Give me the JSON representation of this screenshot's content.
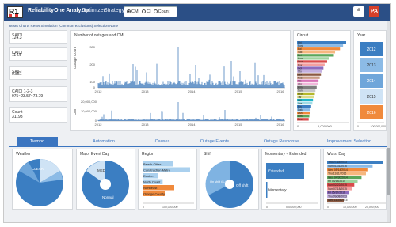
{
  "header": {
    "logo": "R1",
    "title": "ReliabilityOne Analyzer",
    "nav": [
      "Optimizer",
      "Strategy"
    ],
    "metric_options": [
      {
        "label": "CMI",
        "selected": true
      },
      {
        "label": "CI",
        "selected": false
      },
      {
        "label": "Count",
        "selected": false
      }
    ],
    "collapse_icon": "double-chevron-down-icon",
    "user_badge": "PA"
  },
  "breadcrumb": "Reset Charts  Reset Simulation (Common exclusions)  Selection None",
  "metrics": [
    {
      "label": "SAIDI",
      "value": "124.3"
    },
    {
      "label": "CAIDI",
      "value": "114.5"
    },
    {
      "label": "SAIFI",
      "value": "0.851"
    },
    {
      "label": "CAIDI 1-2-3",
      "value": "975~23.57~73.79"
    },
    {
      "label": "Count",
      "value": "31198"
    }
  ],
  "timeline": {
    "title": "Number of outages and CMI",
    "upper_ylabel": "Outage Count",
    "lower_ylabel": "CMI",
    "upper_ticks": [
      "300",
      "200",
      "100",
      "0"
    ],
    "lower_ticks": [
      "20,000,000",
      "10,000,000",
      "0"
    ],
    "x_ticks": [
      "2012",
      "2013",
      "2014",
      "2015",
      "2016"
    ]
  },
  "circuit": {
    "title": "Circuit",
    "x_ticks": [
      "0",
      "5,000,000"
    ],
    "rows": [
      "Shi",
      "Rost",
      "Bal",
      "Sali",
      "Del",
      "Hom",
      "Dua",
      "Fox",
      "Gol",
      "Sto",
      "Lex",
      "Pos",
      "Vix",
      "Chr",
      "Kim",
      "Sun",
      "Bea",
      "Tar",
      "Wil",
      "Gre",
      "Pin",
      "Dak",
      "Ash",
      "Elm",
      "Ree"
    ],
    "values": [
      8,
      7.5,
      7,
      6.2,
      6,
      5.2,
      4.9,
      4.5,
      4.3,
      4.1,
      3.9,
      3.7,
      3.5,
      3.4,
      3.2,
      3,
      2.9,
      2.8,
      2.6,
      2.5,
      2.3,
      2.2,
      2.1,
      2,
      1.9
    ]
  },
  "year": {
    "title": "Year",
    "items": [
      "2012",
      "2013",
      "2014",
      "2015",
      "2016"
    ],
    "axis": "0",
    "axis_end": "100,000,000"
  },
  "tabs": [
    "Tiempo",
    "Automation",
    "Causes",
    "Outage Events",
    "Outage Response",
    "Improvement Selection"
  ],
  "weather": {
    "title": "Weather",
    "label": "CLEAR"
  },
  "major_event": {
    "title": "Major Event Day",
    "labels": [
      "MED",
      "Normal"
    ]
  },
  "region": {
    "title": "Region",
    "items": [
      "Beach Cities",
      "Construction Metro",
      "Eastern",
      "North Coast",
      "Northeast",
      "Orange County"
    ],
    "values": [
      58,
      90,
      30,
      38,
      60,
      42
    ],
    "colors": [
      "#aad0ee",
      "#aad0ee",
      "#aad0ee",
      "#aad0ee",
      "#f08a3c",
      "#f08a3c"
    ],
    "x_ticks": [
      "0",
      "100,000,000"
    ]
  },
  "shift": {
    "title": "Shift",
    "labels": [
      "On shift (8-4pm)",
      "Off shift"
    ]
  },
  "momentary": {
    "title": "Momentary v Extended",
    "items": [
      "Extended",
      "Momentary"
    ],
    "values": [
      100,
      2
    ],
    "x_ticks": [
      "0",
      "500,000,000"
    ]
  },
  "week_day": {
    "title": "Worst Day",
    "items": [
      "Thu 07/18/2013",
      "Sun 01/31/2016",
      "Wed 05/14/2014",
      "Thu 11/11/2016",
      "Wed 04/30/2014",
      "Fri 04/18/2014",
      "Sun 02/22/2015",
      "Sun 07/18/2015",
      "Fri 05/17/2016",
      "Thu 09/08/2013",
      "Wed 11/25/2015"
    ],
    "values": [
      100,
      82,
      74,
      70,
      62,
      55,
      49,
      45,
      40,
      36,
      30
    ],
    "x_ticks": [
      "0",
      "10,000,000",
      "20,000,000"
    ]
  }
}
